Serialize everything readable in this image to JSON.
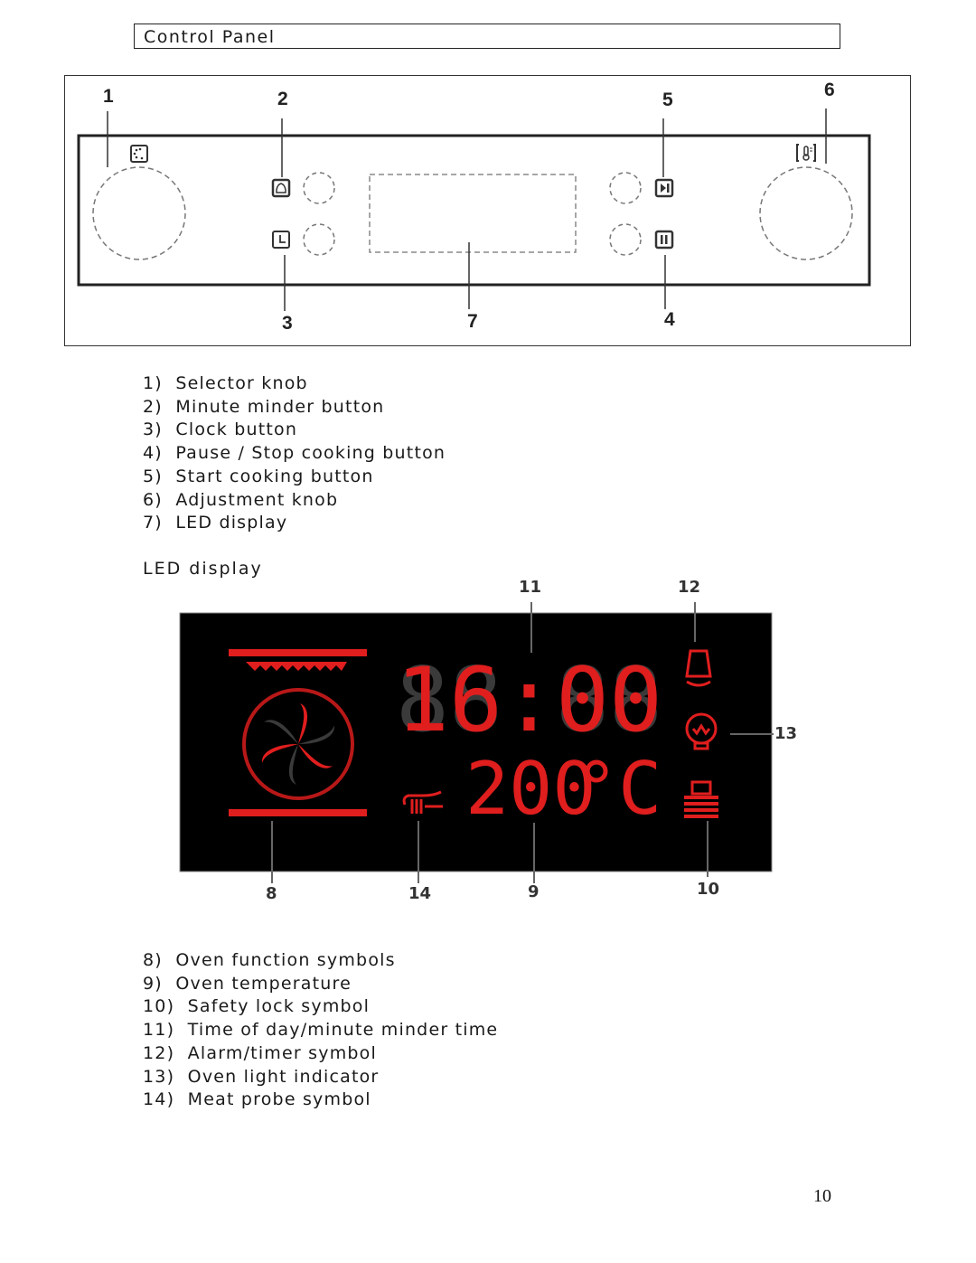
{
  "header": {
    "title": "Control Panel"
  },
  "control_panel": {
    "callouts": [
      "1",
      "2",
      "3",
      "4",
      "5",
      "6",
      "7"
    ],
    "icons": {
      "selector": "oven-function-icon",
      "minute_minder": "bell-icon",
      "clock": "clock-icon",
      "start": "play-pause-icon",
      "pause": "pause-icon",
      "adjust": "thermometer-icon"
    },
    "legend": [
      "1)  Selector knob",
      "2)  Minute minder button",
      "3)  Clock button",
      "4)  Pause / Stop cooking button",
      "5)  Start cooking button",
      "6)  Adjustment knob",
      "7)  LED display"
    ]
  },
  "led_section": {
    "title": "LED display",
    "callouts": [
      "8",
      "9",
      "10",
      "11",
      "12",
      "13",
      "14"
    ],
    "time_readout": "16:00",
    "temperature_readout": "200",
    "temperature_unit": "°C",
    "colors": {
      "lit": "#e01e1e",
      "unlit": "#3a3a3a",
      "background": "#000000"
    },
    "legend": [
      "8)  Oven function symbols",
      "9)  Oven temperature",
      "10)  Safety lock symbol",
      "11)  Time of day/minute minder time",
      "12)  Alarm/timer symbol",
      "13)  Oven light indicator",
      "14)  Meat probe symbol"
    ]
  },
  "footer": {
    "page_number": "10"
  }
}
